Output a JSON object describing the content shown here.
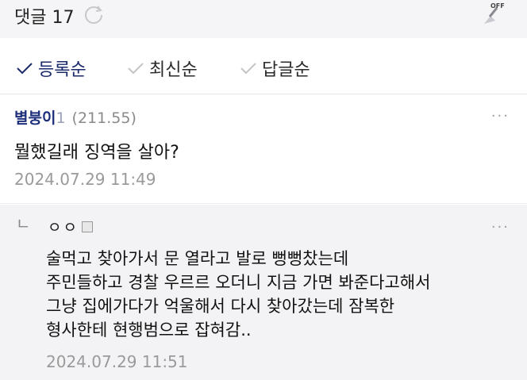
{
  "header": {
    "title": "댓글 17",
    "refresh_icon": "refresh-icon",
    "clean_icon": "broom-off-icon",
    "clean_badge": "OFF"
  },
  "sort_options": [
    {
      "label": "등록순",
      "selected": true
    },
    {
      "label": "최신순",
      "selected": false
    },
    {
      "label": "답글순",
      "selected": false
    }
  ],
  "comments": [
    {
      "author": "별붕이",
      "level": "1",
      "ip": "(211.55)",
      "body": "뭘했길래 징역을 살아?",
      "date": "2024.07.29 11:49",
      "more": "···"
    }
  ],
  "reply": {
    "arrow": "ㄴ",
    "author": "ㅇㅇ",
    "body_lines": [
      "술먹고 찾아가서 문 열라고 발로 뻥뻥찼는데",
      "주민들하고 경찰 우르르 오더니 지금 가면 봐준다고해서",
      "그냥 집에가다가 억울해서 다시 찾아갔는데 잠복한",
      "형사한테 현행범으로 잡혀감.."
    ],
    "date": "2024.07.29 11:51",
    "more": "···"
  },
  "colors": {
    "accent": "#1b2a6b",
    "header_bg": "#f5f5f7",
    "reply_bg": "#f3f3f5",
    "muted": "#9a9a9a"
  }
}
